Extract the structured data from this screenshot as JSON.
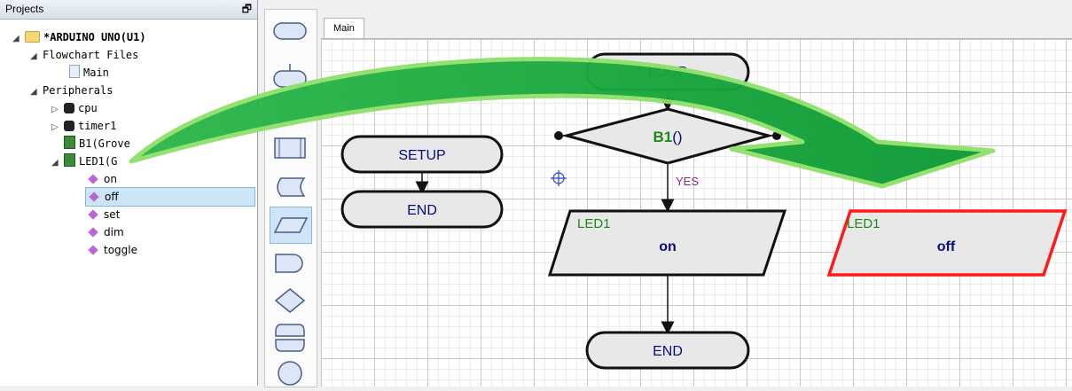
{
  "projects": {
    "title": "Projects",
    "pin": "🗗",
    "tree": {
      "root": "*ARDUINO UNO(U1)",
      "flowchart_files": "Flowchart Files",
      "main_file": "Main",
      "peripherals": "Peripherals",
      "cpu": "cpu",
      "timer1": "timer1",
      "b1": "B1(Grove",
      "led1": "LED1(G",
      "methods": [
        "on",
        "off",
        "set",
        "dim",
        "toggle"
      ]
    }
  },
  "editor": {
    "tab": "Main"
  },
  "flowchart": {
    "setup": "SETUP",
    "setup_end": "END",
    "loop": "LOOP",
    "decision_name": "B1",
    "decision_args": "()",
    "yes_label": "YES",
    "led_on_device": "LED1",
    "led_on_action": "on",
    "loop_end": "END",
    "led_off_device": "LED1",
    "led_off_action": "off"
  },
  "colors": {
    "arrow_green": "#17a83a",
    "arrow_light": "#8fe06a",
    "highlight_red": "#ff1a1a",
    "device_green": "#1a8a1a",
    "text_navy": "#0a0a80",
    "block_fill": "#e8e8e8",
    "yes_purple": "#8a2a8a"
  }
}
